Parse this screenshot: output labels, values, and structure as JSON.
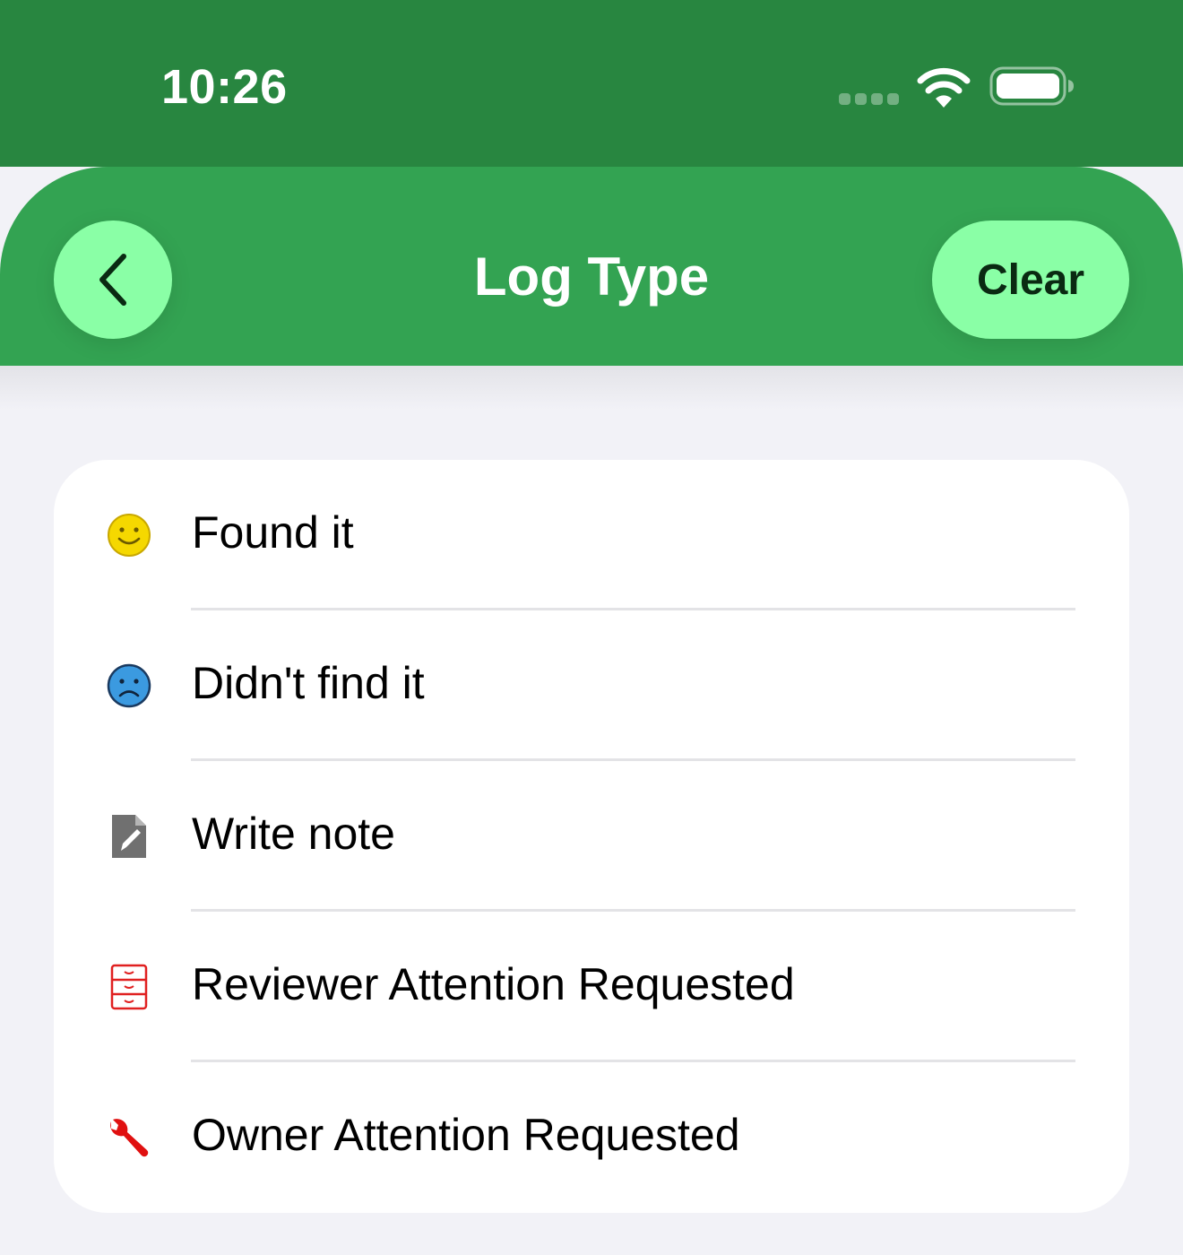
{
  "status_bar": {
    "time": "10:26",
    "icons": [
      "cellular-signal-icon",
      "wifi-icon",
      "battery-icon"
    ]
  },
  "nav": {
    "title": "Log Type",
    "back_icon": "chevron-left-icon",
    "clear_label": "Clear"
  },
  "log_types": [
    {
      "label": "Found it",
      "icon": "smiley-face-icon",
      "icon_color": "#f5d800"
    },
    {
      "label": "Didn't find it",
      "icon": "frowning-face-icon",
      "icon_color": "#3b9ae0"
    },
    {
      "label": "Write note",
      "icon": "note-pencil-icon",
      "icon_color": "#707070"
    },
    {
      "label": "Reviewer Attention Requested",
      "icon": "filing-cabinet-icon",
      "icon_color": "#e02020"
    },
    {
      "label": "Owner Attention Requested",
      "icon": "wrench-icon",
      "icon_color": "#e01010"
    }
  ],
  "colors": {
    "status_bar": "#288640",
    "nav_bar": "#33a352",
    "accent_button": "#8affa6",
    "background": "#f2f2f7"
  }
}
